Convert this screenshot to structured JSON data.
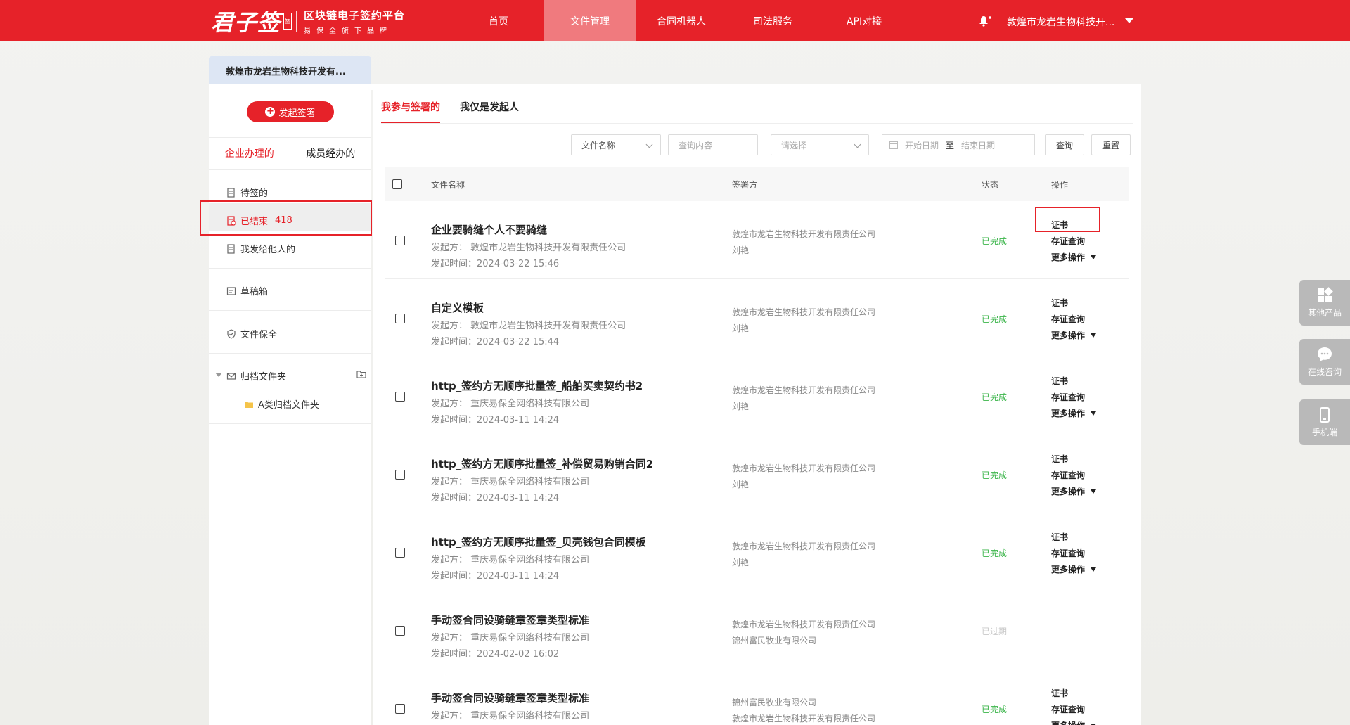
{
  "header": {
    "logo_mark": "君子签",
    "logo_seal": "签",
    "platform_title": "区块链电子签约平台",
    "platform_sub": "易保全旗下品牌",
    "nav": [
      {
        "label": "首页",
        "active": false
      },
      {
        "label": "文件管理",
        "active": true
      },
      {
        "label": "合同机器人",
        "active": false
      },
      {
        "label": "司法服务",
        "active": false
      },
      {
        "label": "API对接",
        "active": false
      }
    ],
    "user_name": "敦煌市龙岩生物科技开...",
    "bell_icon": "bell-icon",
    "caret_icon": "caret-down-icon"
  },
  "company_tab": "敦煌市龙岩生物科技开发有...",
  "sidebar": {
    "start_button": "发起签署",
    "tabs": [
      {
        "label": "企业办理的",
        "active": true
      },
      {
        "label": "成员经办的",
        "active": false
      }
    ],
    "items": [
      {
        "label": "待签的",
        "icon": "doc-icon"
      },
      {
        "label": "已结束",
        "count": "418",
        "icon": "doc-check-icon"
      },
      {
        "label": "我发给他人的",
        "icon": "doc-send-icon"
      },
      {
        "label": "草稿箱",
        "icon": "draft-icon"
      },
      {
        "label": "文件保全",
        "icon": "shield-icon"
      },
      {
        "label": "归档文件夹",
        "icon": "archive-icon"
      },
      {
        "label": "A类归档文件夹",
        "icon": "folder-icon"
      }
    ]
  },
  "main": {
    "tabs": [
      {
        "label": "我参与签署的",
        "active": true
      },
      {
        "label": "我仅是发起人",
        "active": false
      }
    ],
    "filters": {
      "field_select": "文件名称",
      "query_placeholder": "查询内容",
      "status_placeholder": "请选择",
      "date_start_placeholder": "开始日期",
      "date_sep": "至",
      "date_end_placeholder": "结束日期",
      "search_button": "查询",
      "reset_button": "重置"
    },
    "table": {
      "headers": [
        "文件名称",
        "签署方",
        "状态",
        "操作"
      ],
      "initiator_label": "发起方：",
      "time_label": "发起时间：",
      "actions": {
        "cert": "证书",
        "evidence": "存证查询",
        "more": "更多操作"
      },
      "rows": [
        {
          "title": "企业要骑缝个人不要骑缝",
          "initiator": "敦煌市龙岩生物科技开发有限责任公司",
          "time": "2024-03-22 15:46",
          "signers": [
            "敦煌市龙岩生物科技开发有限责任公司",
            "刘艳"
          ],
          "status": "已完成",
          "expired": false
        },
        {
          "title": "自定义模板",
          "initiator": "敦煌市龙岩生物科技开发有限责任公司",
          "time": "2024-03-22 15:44",
          "signers": [
            "敦煌市龙岩生物科技开发有限责任公司",
            "刘艳"
          ],
          "status": "已完成",
          "expired": false
        },
        {
          "title": "http_签约方无顺序批量签_船舶买卖契约书2",
          "initiator": "重庆易保全网络科技有限公司",
          "time": "2024-03-11 14:24",
          "signers": [
            "敦煌市龙岩生物科技开发有限责任公司",
            "刘艳"
          ],
          "status": "已完成",
          "expired": false
        },
        {
          "title": "http_签约方无顺序批量签_补偿贸易购销合同2",
          "initiator": "重庆易保全网络科技有限公司",
          "time": "2024-03-11 14:24",
          "signers": [
            "敦煌市龙岩生物科技开发有限责任公司",
            "刘艳"
          ],
          "status": "已完成",
          "expired": false
        },
        {
          "title": "http_签约方无顺序批量签_贝壳钱包合同模板",
          "initiator": "重庆易保全网络科技有限公司",
          "time": "2024-03-11 14:24",
          "signers": [
            "敦煌市龙岩生物科技开发有限责任公司",
            "刘艳"
          ],
          "status": "已完成",
          "expired": false
        },
        {
          "title": "手动签合同设骑缝章签章类型标准",
          "initiator": "重庆易保全网络科技有限公司",
          "time": "2024-02-02 16:02",
          "signers": [
            "敦煌市龙岩生物科技开发有限责任公司",
            "锦州富民牧业有限公司"
          ],
          "status": "已过期",
          "expired": true
        },
        {
          "title": "手动签合同设骑缝章签章类型标准",
          "initiator": "重庆易保全网络科技有限公司",
          "time": "",
          "signers": [
            "锦州富民牧业有限公司",
            "敦煌市龙岩生物科技开发有限责任公司"
          ],
          "status": "已完成",
          "expired": false
        }
      ]
    }
  },
  "float": [
    {
      "label": "其他产品",
      "icon": "apps-icon"
    },
    {
      "label": "在线咨询",
      "icon": "chat-icon"
    },
    {
      "label": "手机端",
      "icon": "phone-icon"
    }
  ],
  "colors": {
    "brand": "#e62229",
    "nav_active": "#f07a7e",
    "success": "#3bb54a",
    "expired": "#c9c9c9"
  }
}
